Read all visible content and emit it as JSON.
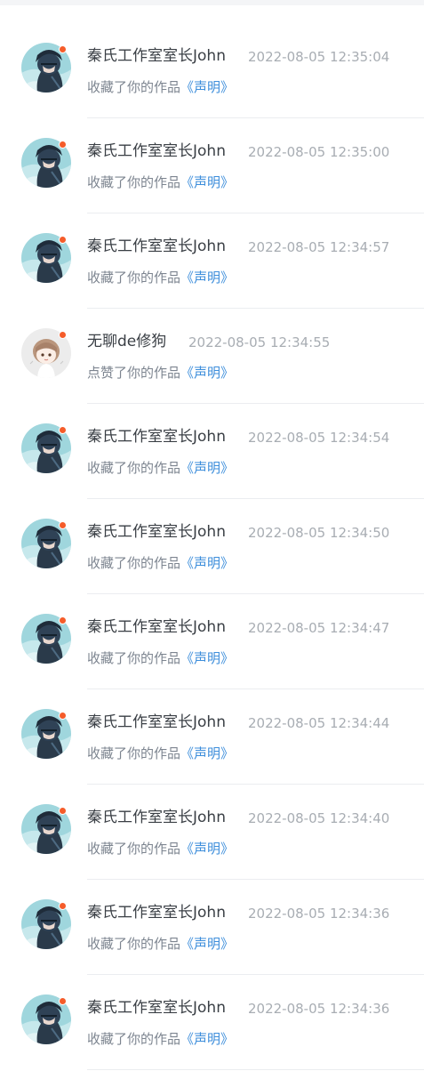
{
  "notifications": [
    {
      "user": "秦氏工作室室长John",
      "time": "2022-08-05 12:35:04",
      "action": "收藏了你的作品",
      "work": "《声明》",
      "avatar": "avatar-anime-dark-hair-icon"
    },
    {
      "user": "秦氏工作室室长John",
      "time": "2022-08-05 12:35:00",
      "action": "收藏了你的作品",
      "work": "《声明》",
      "avatar": "avatar-anime-dark-hair-icon"
    },
    {
      "user": "秦氏工作室室长John",
      "time": "2022-08-05 12:34:57",
      "action": "收藏了你的作品",
      "work": "《声明》",
      "avatar": "avatar-anime-dark-hair-icon"
    },
    {
      "user": "无聊de修狗",
      "time": "2022-08-05 12:34:55",
      "action": "点赞了你的作品",
      "work": "《声明》",
      "avatar": "avatar-chibi-girl-icon"
    },
    {
      "user": "秦氏工作室室长John",
      "time": "2022-08-05 12:34:54",
      "action": "收藏了你的作品",
      "work": "《声明》",
      "avatar": "avatar-anime-dark-hair-icon"
    },
    {
      "user": "秦氏工作室室长John",
      "time": "2022-08-05 12:34:50",
      "action": "收藏了你的作品",
      "work": "《声明》",
      "avatar": "avatar-anime-dark-hair-icon"
    },
    {
      "user": "秦氏工作室室长John",
      "time": "2022-08-05 12:34:47",
      "action": "收藏了你的作品",
      "work": "《声明》",
      "avatar": "avatar-anime-dark-hair-icon"
    },
    {
      "user": "秦氏工作室室长John",
      "time": "2022-08-05 12:34:44",
      "action": "收藏了你的作品",
      "work": "《声明》",
      "avatar": "avatar-anime-dark-hair-icon"
    },
    {
      "user": "秦氏工作室室长John",
      "time": "2022-08-05 12:34:40",
      "action": "收藏了你的作品",
      "work": "《声明》",
      "avatar": "avatar-anime-dark-hair-icon"
    },
    {
      "user": "秦氏工作室室长John",
      "time": "2022-08-05 12:34:36",
      "action": "收藏了你的作品",
      "work": "《声明》",
      "avatar": "avatar-anime-dark-hair-icon"
    },
    {
      "user": "秦氏工作室室长John",
      "time": "2022-08-05 12:34:36",
      "action": "收藏了你的作品",
      "work": "《声明》",
      "avatar": "avatar-anime-dark-hair-icon"
    }
  ],
  "colors": {
    "unread_dot": "#f55c2a",
    "link": "#3d8edb",
    "name": "#3a3f45",
    "time": "#a8adb3",
    "action": "#7d8590"
  }
}
